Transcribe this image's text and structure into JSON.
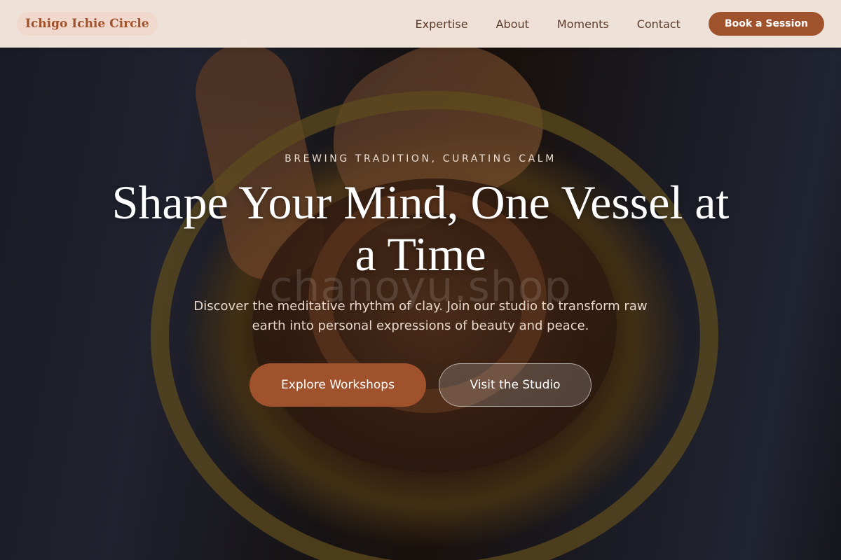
{
  "nav": {
    "logo": "Ichigo Ichie Circle",
    "links": [
      "Expertise",
      "About",
      "Moments",
      "Contact"
    ],
    "cta": "Book a Session"
  },
  "hero": {
    "eyebrow": "BREWING TRADITION, CURATING CALM",
    "headline": "Shape Your Mind, One Vessel at a Time",
    "watermark": "chanoyu.shop",
    "subtitle": "Discover the meditative rhythm of clay. Join our studio to transform raw earth into personal expressions of beauty and peace.",
    "primary_cta": "Explore Workshops",
    "secondary_cta": "Visit the Studio"
  },
  "colors": {
    "accent": "#a0522d",
    "nav_bg": "#faece2"
  }
}
